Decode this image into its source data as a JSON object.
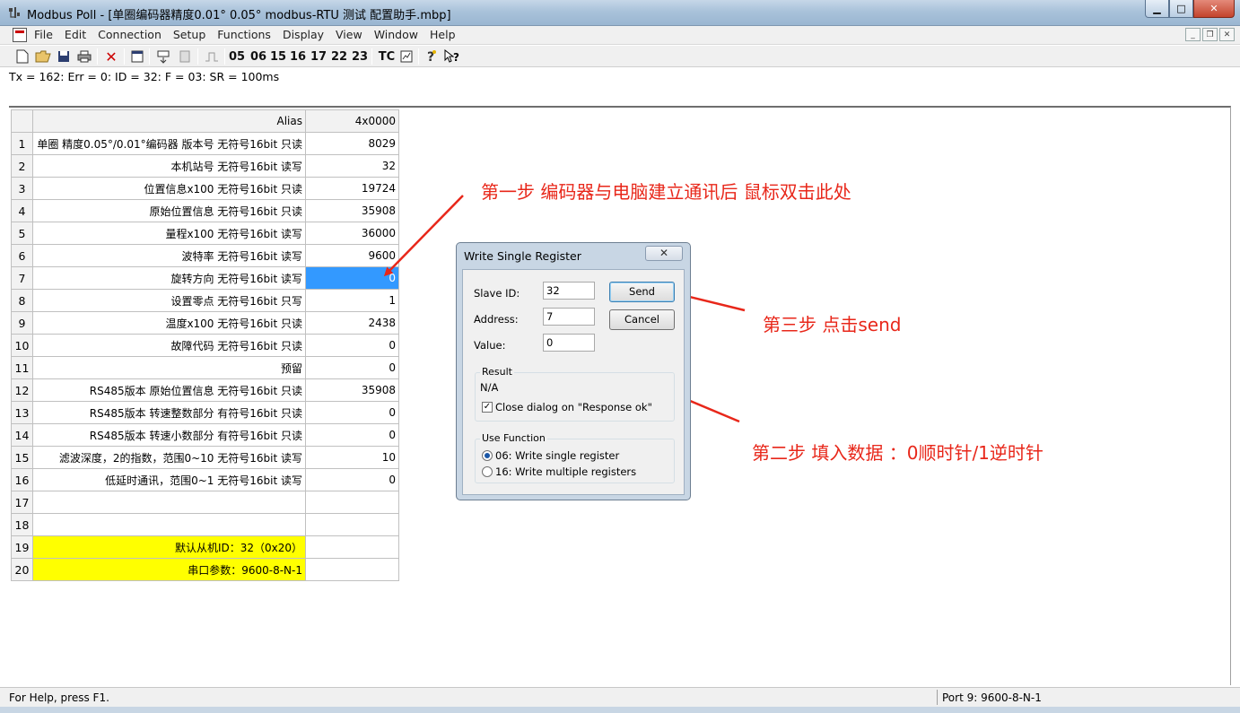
{
  "window": {
    "title": "Modbus Poll - [单圈编码器精度0.01° 0.05° modbus-RTU 测试 配置助手.mbp]",
    "minimize": "▁",
    "maximize": "□",
    "close": "✕"
  },
  "menu": {
    "items": [
      "File",
      "Edit",
      "Connection",
      "Setup",
      "Functions",
      "Display",
      "View",
      "Window",
      "Help"
    ],
    "mdi_minimize": "_",
    "mdi_restore": "❐",
    "mdi_close": "✕"
  },
  "toolbar": {
    "codes": [
      "05",
      "06",
      "15",
      "16",
      "17",
      "22",
      "23"
    ],
    "tc": "TC"
  },
  "status_line": "Tx = 162: Err = 0: ID = 32: F = 03: SR = 100ms",
  "grid": {
    "header_alias": "Alias",
    "header_value": "4x0000",
    "rows": [
      {
        "n": "1",
        "alias": "单圈 精度0.05°/0.01°编码器 版本号 无符号16bit 只读",
        "value": "8029"
      },
      {
        "n": "2",
        "alias": "本机站号 无符号16bit 读写",
        "value": "32"
      },
      {
        "n": "3",
        "alias": "位置信息x100 无符号16bit 只读",
        "value": "19724"
      },
      {
        "n": "4",
        "alias": "原始位置信息 无符号16bit 只读",
        "value": "35908"
      },
      {
        "n": "5",
        "alias": "量程x100 无符号16bit 读写",
        "value": "36000"
      },
      {
        "n": "6",
        "alias": "波特率 无符号16bit 读写",
        "value": "9600"
      },
      {
        "n": "7",
        "alias": "旋转方向 无符号16bit 读写",
        "value": "0"
      },
      {
        "n": "8",
        "alias": "设置零点 无符号16bit 只写",
        "value": "1"
      },
      {
        "n": "9",
        "alias": "温度x100 无符号16bit 只读",
        "value": "2438"
      },
      {
        "n": "10",
        "alias": "故障代码 无符号16bit 只读",
        "value": "0"
      },
      {
        "n": "11",
        "alias": "预留",
        "value": "0"
      },
      {
        "n": "12",
        "alias": "RS485版本 原始位置信息 无符号16bit 只读",
        "value": "35908"
      },
      {
        "n": "13",
        "alias": "RS485版本 转速整数部分 有符号16bit 只读",
        "value": "0"
      },
      {
        "n": "14",
        "alias": "RS485版本 转速小数部分 有符号16bit 只读",
        "value": "0"
      },
      {
        "n": "15",
        "alias": "滤波深度，2的指数，范围0~10 无符号16bit 读写",
        "value": "10"
      },
      {
        "n": "16",
        "alias": "低延时通讯，范围0~1 无符号16bit 读写",
        "value": "0"
      },
      {
        "n": "17",
        "alias": "",
        "value": ""
      },
      {
        "n": "18",
        "alias": "",
        "value": ""
      },
      {
        "n": "19",
        "alias": "默认从机ID：32（0x20）",
        "value": ""
      },
      {
        "n": "20",
        "alias": "串口参数：9600-8-N-1",
        "value": ""
      }
    ],
    "highlight_color": "#ffff00",
    "selected_color": "#3399ff"
  },
  "dialog": {
    "title": "Write Single Register",
    "close": "✕",
    "slave_id_label": "Slave ID:",
    "slave_id_value": "32",
    "address_label": "Address:",
    "address_value": "7",
    "value_label": "Value:",
    "value_value": "0",
    "send": "Send",
    "cancel": "Cancel",
    "result_legend": "Result",
    "result_text": "N/A",
    "close_on_ok": "Close dialog on \"Response ok\"",
    "use_function_legend": "Use Function",
    "option_06": "06: Write single register",
    "option_16": "16: Write multiple registers"
  },
  "annotations": {
    "step1": "第一步 编码器与电脑建立通讯后 鼠标双击此处",
    "step2": "第二步 填入数据 ：0顺时针/1逆时针",
    "step3": "第三步 点击send",
    "color": "#e8271a"
  },
  "statusbar": {
    "help": "For Help, press F1.",
    "port": "Port 9: 9600-8-N-1"
  }
}
